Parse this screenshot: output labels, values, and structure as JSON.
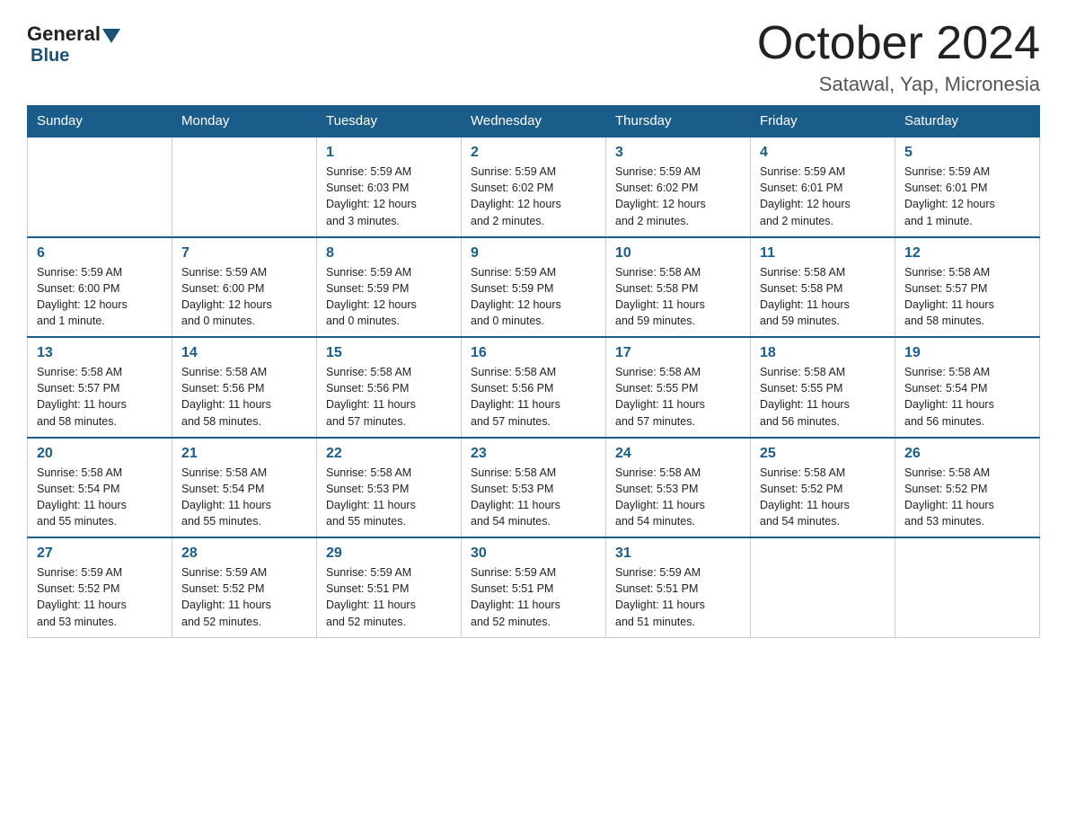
{
  "header": {
    "logo": {
      "general": "General",
      "blue": "Blue"
    },
    "title": "October 2024",
    "location": "Satawal, Yap, Micronesia"
  },
  "days_of_week": [
    "Sunday",
    "Monday",
    "Tuesday",
    "Wednesday",
    "Thursday",
    "Friday",
    "Saturday"
  ],
  "weeks": [
    [
      {
        "day": "",
        "info": ""
      },
      {
        "day": "",
        "info": ""
      },
      {
        "day": "1",
        "info": "Sunrise: 5:59 AM\nSunset: 6:03 PM\nDaylight: 12 hours\nand 3 minutes."
      },
      {
        "day": "2",
        "info": "Sunrise: 5:59 AM\nSunset: 6:02 PM\nDaylight: 12 hours\nand 2 minutes."
      },
      {
        "day": "3",
        "info": "Sunrise: 5:59 AM\nSunset: 6:02 PM\nDaylight: 12 hours\nand 2 minutes."
      },
      {
        "day": "4",
        "info": "Sunrise: 5:59 AM\nSunset: 6:01 PM\nDaylight: 12 hours\nand 2 minutes."
      },
      {
        "day": "5",
        "info": "Sunrise: 5:59 AM\nSunset: 6:01 PM\nDaylight: 12 hours\nand 1 minute."
      }
    ],
    [
      {
        "day": "6",
        "info": "Sunrise: 5:59 AM\nSunset: 6:00 PM\nDaylight: 12 hours\nand 1 minute."
      },
      {
        "day": "7",
        "info": "Sunrise: 5:59 AM\nSunset: 6:00 PM\nDaylight: 12 hours\nand 0 minutes."
      },
      {
        "day": "8",
        "info": "Sunrise: 5:59 AM\nSunset: 5:59 PM\nDaylight: 12 hours\nand 0 minutes."
      },
      {
        "day": "9",
        "info": "Sunrise: 5:59 AM\nSunset: 5:59 PM\nDaylight: 12 hours\nand 0 minutes."
      },
      {
        "day": "10",
        "info": "Sunrise: 5:58 AM\nSunset: 5:58 PM\nDaylight: 11 hours\nand 59 minutes."
      },
      {
        "day": "11",
        "info": "Sunrise: 5:58 AM\nSunset: 5:58 PM\nDaylight: 11 hours\nand 59 minutes."
      },
      {
        "day": "12",
        "info": "Sunrise: 5:58 AM\nSunset: 5:57 PM\nDaylight: 11 hours\nand 58 minutes."
      }
    ],
    [
      {
        "day": "13",
        "info": "Sunrise: 5:58 AM\nSunset: 5:57 PM\nDaylight: 11 hours\nand 58 minutes."
      },
      {
        "day": "14",
        "info": "Sunrise: 5:58 AM\nSunset: 5:56 PM\nDaylight: 11 hours\nand 58 minutes."
      },
      {
        "day": "15",
        "info": "Sunrise: 5:58 AM\nSunset: 5:56 PM\nDaylight: 11 hours\nand 57 minutes."
      },
      {
        "day": "16",
        "info": "Sunrise: 5:58 AM\nSunset: 5:56 PM\nDaylight: 11 hours\nand 57 minutes."
      },
      {
        "day": "17",
        "info": "Sunrise: 5:58 AM\nSunset: 5:55 PM\nDaylight: 11 hours\nand 57 minutes."
      },
      {
        "day": "18",
        "info": "Sunrise: 5:58 AM\nSunset: 5:55 PM\nDaylight: 11 hours\nand 56 minutes."
      },
      {
        "day": "19",
        "info": "Sunrise: 5:58 AM\nSunset: 5:54 PM\nDaylight: 11 hours\nand 56 minutes."
      }
    ],
    [
      {
        "day": "20",
        "info": "Sunrise: 5:58 AM\nSunset: 5:54 PM\nDaylight: 11 hours\nand 55 minutes."
      },
      {
        "day": "21",
        "info": "Sunrise: 5:58 AM\nSunset: 5:54 PM\nDaylight: 11 hours\nand 55 minutes."
      },
      {
        "day": "22",
        "info": "Sunrise: 5:58 AM\nSunset: 5:53 PM\nDaylight: 11 hours\nand 55 minutes."
      },
      {
        "day": "23",
        "info": "Sunrise: 5:58 AM\nSunset: 5:53 PM\nDaylight: 11 hours\nand 54 minutes."
      },
      {
        "day": "24",
        "info": "Sunrise: 5:58 AM\nSunset: 5:53 PM\nDaylight: 11 hours\nand 54 minutes."
      },
      {
        "day": "25",
        "info": "Sunrise: 5:58 AM\nSunset: 5:52 PM\nDaylight: 11 hours\nand 54 minutes."
      },
      {
        "day": "26",
        "info": "Sunrise: 5:58 AM\nSunset: 5:52 PM\nDaylight: 11 hours\nand 53 minutes."
      }
    ],
    [
      {
        "day": "27",
        "info": "Sunrise: 5:59 AM\nSunset: 5:52 PM\nDaylight: 11 hours\nand 53 minutes."
      },
      {
        "day": "28",
        "info": "Sunrise: 5:59 AM\nSunset: 5:52 PM\nDaylight: 11 hours\nand 52 minutes."
      },
      {
        "day": "29",
        "info": "Sunrise: 5:59 AM\nSunset: 5:51 PM\nDaylight: 11 hours\nand 52 minutes."
      },
      {
        "day": "30",
        "info": "Sunrise: 5:59 AM\nSunset: 5:51 PM\nDaylight: 11 hours\nand 52 minutes."
      },
      {
        "day": "31",
        "info": "Sunrise: 5:59 AM\nSunset: 5:51 PM\nDaylight: 11 hours\nand 51 minutes."
      },
      {
        "day": "",
        "info": ""
      },
      {
        "day": "",
        "info": ""
      }
    ]
  ]
}
